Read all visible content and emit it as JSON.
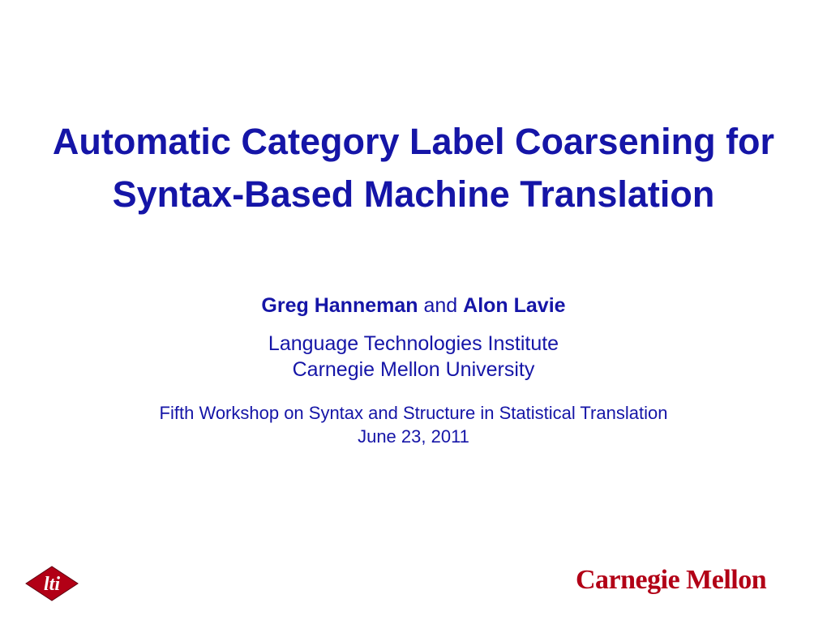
{
  "title": "Automatic Category Label Coarsening for Syntax-Based Machine Translation",
  "author1": "Greg Hanneman",
  "authorConnector": " and ",
  "author2": "Alon Lavie",
  "affiliation1": "Language Technologies Institute",
  "affiliation2": "Carnegie Mellon University",
  "event": "Fifth Workshop on Syntax and Structure in Statistical Translation",
  "date": "June 23, 2011",
  "logoLeft": "lti",
  "logoRight": "Carnegie Mellon"
}
